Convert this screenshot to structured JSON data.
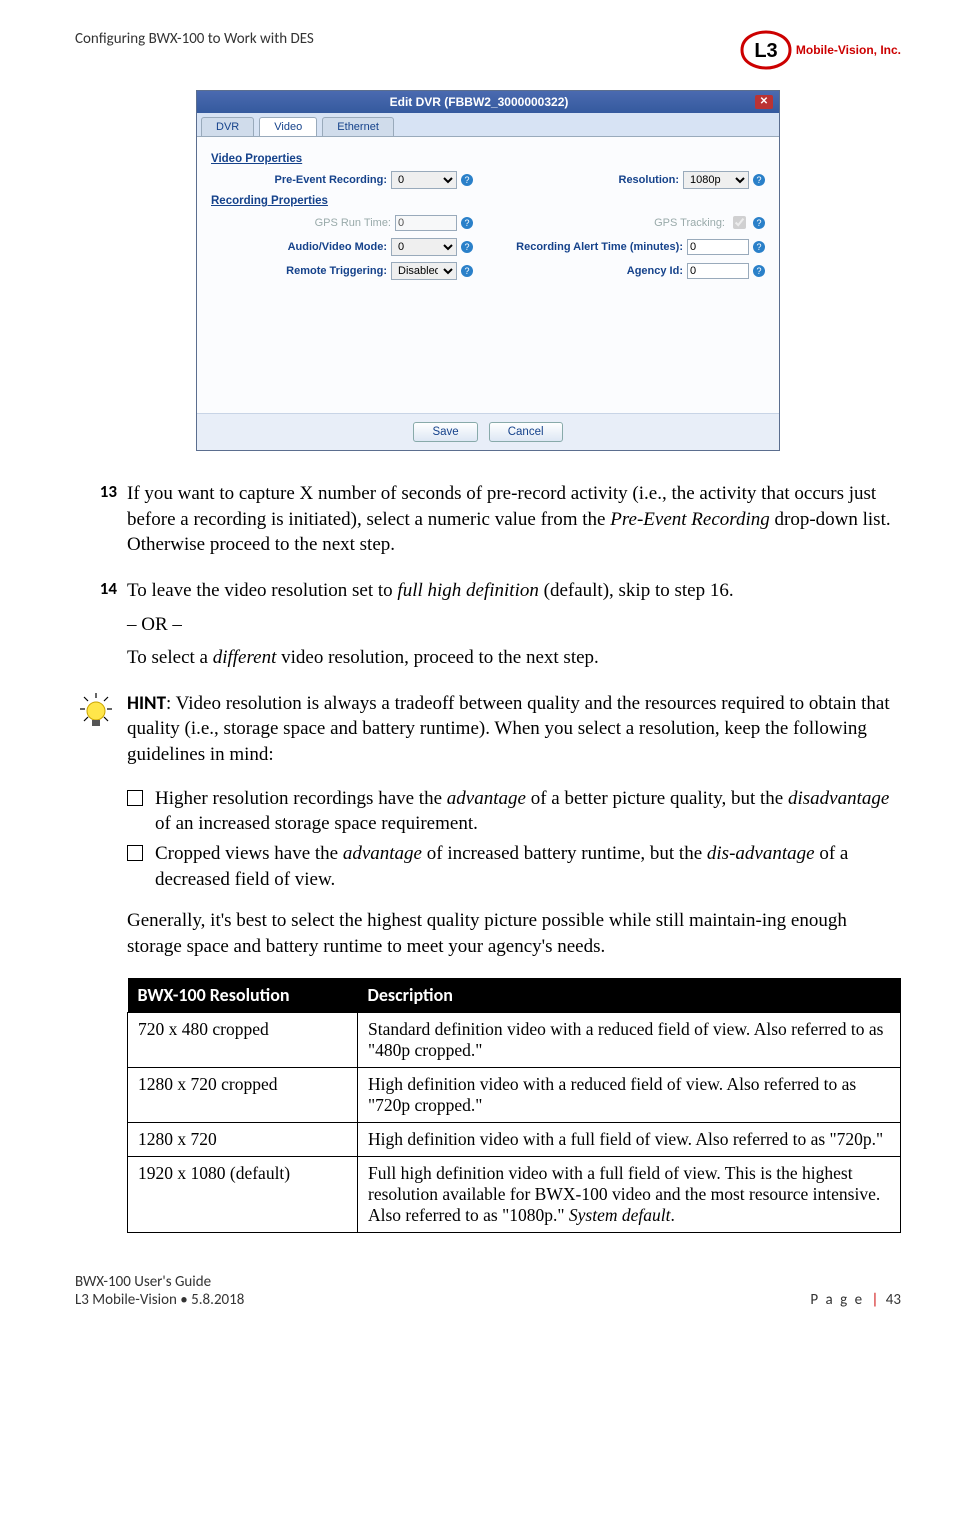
{
  "header": {
    "title": "Configuring BWX-100 to Work with DES",
    "logo_text": "Mobile-Vision, Inc."
  },
  "dialog": {
    "title": "Edit DVR (FBBW2_3000000322)",
    "tabs": [
      "DVR",
      "Video",
      "Ethernet"
    ],
    "section_video": "Video Properties",
    "section_recording": "Recording Properties",
    "fields": {
      "pre_event_label": "Pre-Event Recording:",
      "pre_event_value": "0",
      "resolution_label": "Resolution:",
      "resolution_value": "1080p",
      "gps_run_label": "GPS Run Time:",
      "gps_run_value": "0",
      "gps_tracking_label": "GPS Tracking:",
      "av_mode_label": "Audio/Video Mode:",
      "av_mode_value": "0",
      "alert_label": "Recording Alert Time (minutes):",
      "alert_value": "0",
      "remote_label": "Remote Triggering:",
      "remote_value": "Disabled",
      "agency_label": "Agency Id:",
      "agency_value": "0"
    },
    "buttons": {
      "save": "Save",
      "cancel": "Cancel"
    }
  },
  "steps": {
    "s13_num": "13",
    "s13_text_a": "If you want to capture X number of seconds of pre-record activity (i.e., the activity that occurs just before a recording is initiated), select a numeric value from the ",
    "s13_em": "Pre-Event Recording",
    "s13_text_b": " drop-down list. Otherwise proceed to the next step.",
    "s14_num": "14",
    "s14_text_a": "To leave the video resolution set to ",
    "s14_em1": "full high definition",
    "s14_text_b": " (default), skip to step 16.",
    "s14_or": "– OR –",
    "s14_text_c": "To select a ",
    "s14_em2": "different",
    "s14_text_d": " video resolution, proceed to the next step."
  },
  "hint": {
    "label": "HINT",
    "text": ": Video resolution is always a tradeoff between quality and the resources required to obtain that quality (i.e., storage space and battery runtime). When you select a resolution, keep the following guidelines in mind:"
  },
  "bullets": {
    "b1_a": "Higher resolution recordings have the ",
    "b1_em1": "advantage",
    "b1_b": " of a better picture quality, but the ",
    "b1_em2": "disadvantage",
    "b1_c": " of an increased storage space requirement.",
    "b2_a": "Cropped views have the ",
    "b2_em1": "advantage",
    "b2_b": " of increased battery runtime, but the ",
    "b2_em2": "dis-advantage",
    "b2_c": " of a decreased field of view."
  },
  "generally": "Generally, it's best to select the highest quality picture possible while still maintain-ing enough storage space and battery runtime to meet your agency's needs.",
  "table": {
    "h1": "BWX-100 Resolution",
    "h2": "Description",
    "rows": [
      {
        "res": "720 x 480 cropped",
        "desc": "Standard definition video with a reduced field of view. Also referred to as \"480p cropped.\""
      },
      {
        "res": "1280 x 720 cropped",
        "desc": "High definition video with a reduced field of view. Also referred to as \"720p cropped.\""
      },
      {
        "res": "1280 x 720",
        "desc": "High definition video with a full field of view. Also referred to as \"720p.\""
      },
      {
        "res": "1920 x 1080 (default)",
        "desc_a": "Full high definition video with a full field of view. This is the highest resolution available for BWX-100 video and the most resource intensive. Also referred to as \"1080p.\" ",
        "desc_em": "System default",
        "desc_b": "."
      }
    ]
  },
  "footer": {
    "line1": "BWX-100 User's Guide",
    "line2": "L3 Mobile-Vision • 5.8.2018",
    "page_label": "P a g e",
    "page_num": "43"
  }
}
